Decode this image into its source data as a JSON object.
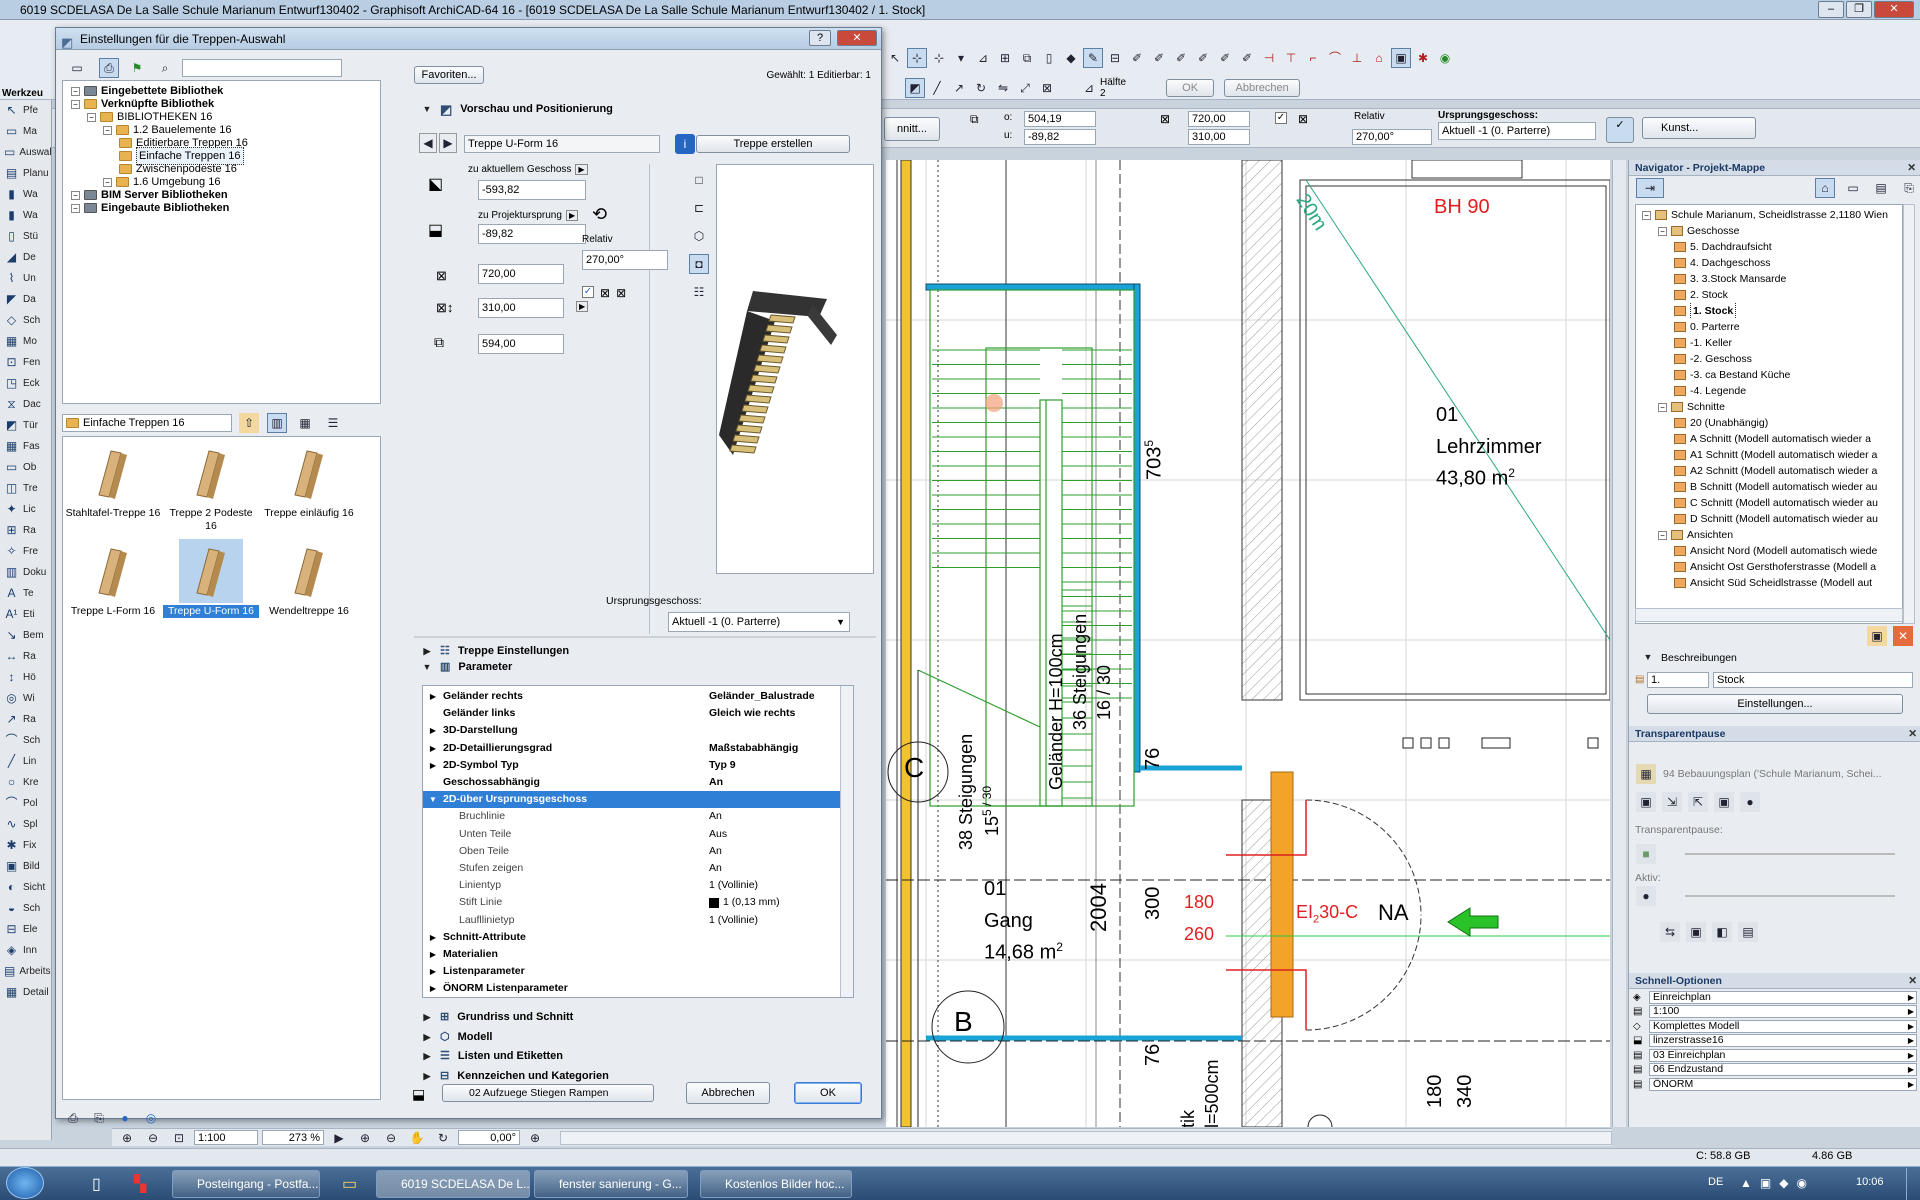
{
  "window": {
    "title": "6019 SCDELASA De La Salle Schule Marianum Entwurf130402 - Graphisoft ArchiCAD-64 16 - [6019 SCDELASA De La Salle Schule Marianum Entwurf130402 / 1. Stock]"
  },
  "toolbar": {
    "ok_label": "OK",
    "cancel_label": "Abbrechen",
    "half_label": "Hälfte",
    "half_value": "2"
  },
  "infobox": {
    "btn_partial": "nnitt...",
    "o_label": "o:",
    "o_value": "504,19",
    "u_label": "u:",
    "u_value": "-89,82",
    "w_value": "720,00",
    "h_value": "310,00",
    "relativ_label": "Relativ",
    "angle_value": "270,00°",
    "origin_label": "Ursprungsgeschoss:",
    "origin_value": "Aktuell -1 (0. Parterre)",
    "kunst_label": "Kunst..."
  },
  "leftpalette": {
    "header": "Werkzeu",
    "items": [
      "Pfe",
      "Ma",
      "Auswahl",
      "Planu",
      "Wa",
      "Wa",
      "Stü",
      "De",
      "Un",
      "Da",
      "Sch",
      "Mo",
      "Fen",
      "Eck",
      "Dac",
      "Tür",
      "Fas",
      "Ob",
      "Tre",
      "Lic",
      "Ra",
      "Fre",
      "Doku",
      "Te",
      "Eti",
      "Bem",
      "Ra",
      "Hö",
      "Wi",
      "Ra",
      "Sch",
      "Lin",
      "Kre",
      "Pol",
      "Spl",
      "Fix",
      "Bild",
      "Sicht",
      "Sch",
      "Ele",
      "Inn",
      "Arbeitsbl",
      "Detail"
    ]
  },
  "dialog": {
    "title": "Einstellungen für die Treppen-Auswahl",
    "favorites": "Favoriten...",
    "selected_info": "Gewählt: 1 Editierbar: 1",
    "library_tree": [
      {
        "label": "Eingebettete Bibliothek",
        "bold": true,
        "level": 0
      },
      {
        "label": "Verknüpfte Bibliothek",
        "bold": true,
        "level": 0
      },
      {
        "label": "BIBLIOTHEKEN 16",
        "bold": false,
        "level": 1
      },
      {
        "label": "1.2 Bauelemente 16",
        "bold": false,
        "level": 2
      },
      {
        "label": "Editierbare Treppen 16",
        "bold": false,
        "level": 3
      },
      {
        "label": "Einfache Treppen 16",
        "bold": false,
        "level": 3,
        "selected": true
      },
      {
        "label": "Zwischenpodeste 16",
        "bold": false,
        "level": 3
      },
      {
        "label": "1.6 Umgebung 16",
        "bold": false,
        "level": 2
      },
      {
        "label": "BIM Server Bibliotheken",
        "bold": true,
        "level": 0
      },
      {
        "label": "Eingebaute Bibliotheken",
        "bold": true,
        "level": 0
      }
    ],
    "folder_select": "Einfache Treppen 16",
    "objects": [
      {
        "label": "Stahltafel-Treppe 16"
      },
      {
        "label": "Treppe 2 Podeste 16"
      },
      {
        "label": "Treppe einläufig 16"
      },
      {
        "label": "Treppe L-Form 16"
      },
      {
        "label": "Treppe U-Form 16",
        "selected": true
      },
      {
        "label": "Wendeltreppe 16"
      }
    ],
    "preview_section": "Vorschau und Positionierung",
    "object_name": "Treppe U-Form 16",
    "create_btn": "Treppe erstellen",
    "to_current_story": "zu aktuellem Geschoss",
    "val_story": "-593,82",
    "to_project_origin": "zu Projektursprung",
    "val_origin": "-89,82",
    "val_width": "720,00",
    "val_depth": "310,00",
    "val_height": "594,00",
    "relativ": "Relativ",
    "angle": "270,00°",
    "origin_story_label": "Ursprungsgeschoss:",
    "origin_story_value": "Aktuell -1 (0. Parterre)",
    "section_stair": "Treppe Einstellungen",
    "section_params": "Parameter",
    "params": [
      {
        "name": "Geländer rechts",
        "value": "Geländer_Balustrade",
        "bold": true,
        "exp": "▶",
        "indent": 0
      },
      {
        "name": "Geländer links",
        "value": "Gleich wie rechts",
        "bold": true,
        "exp": "",
        "indent": 0
      },
      {
        "name": "3D-Darstellung",
        "value": "",
        "bold": true,
        "exp": "▶",
        "indent": 0
      },
      {
        "name": "2D-Detaillierungsgrad",
        "value": "Maßstababhängig",
        "bold": true,
        "exp": "▶",
        "indent": 0
      },
      {
        "name": "2D-Symbol Typ",
        "value": "Typ 9",
        "bold": true,
        "exp": "▶",
        "indent": 0
      },
      {
        "name": "Geschossabhängig",
        "value": "An",
        "bold": true,
        "exp": "",
        "indent": 0
      },
      {
        "name": "2D-über Ursprungsgeschoss",
        "value": "",
        "bold": true,
        "exp": "▼",
        "indent": 0,
        "selected": true
      },
      {
        "name": "Bruchlinie",
        "value": "An",
        "bold": false,
        "exp": "",
        "indent": 1
      },
      {
        "name": "Unten Teile",
        "value": "Aus",
        "bold": false,
        "exp": "",
        "indent": 1
      },
      {
        "name": "Oben Teile",
        "value": "An",
        "bold": false,
        "exp": "",
        "indent": 1
      },
      {
        "name": "Stufen zeigen",
        "value": "An",
        "bold": false,
        "exp": "",
        "indent": 1
      },
      {
        "name": "Linientyp",
        "value": "1 (Vollinie)",
        "bold": false,
        "exp": "",
        "indent": 1
      },
      {
        "name": "Stift Linie",
        "value": "1 (0,13 mm)",
        "bold": false,
        "exp": "",
        "indent": 1,
        "swatch": true
      },
      {
        "name": "Laufllinietyp",
        "value": "1 (Vollinie)",
        "bold": false,
        "exp": "",
        "indent": 1
      },
      {
        "name": "Schnitt-Attribute",
        "value": "",
        "bold": true,
        "exp": "▶",
        "indent": 0
      },
      {
        "name": "Materialien",
        "value": "",
        "bold": true,
        "exp": "▶",
        "indent": 0
      },
      {
        "name": "Listenparameter",
        "value": "",
        "bold": true,
        "exp": "▶",
        "indent": 0
      },
      {
        "name": "ÖNORM Listenparameter",
        "value": "",
        "bold": true,
        "exp": "▶",
        "indent": 0
      }
    ],
    "sections_bottom": [
      "Grundriss und Schnitt",
      "Modell",
      "Listen und Etiketten",
      "Kennzeichen und Kategorien"
    ],
    "layer": "02 Aufzuege Stiegen Rampen",
    "cancel": "Abbrechen",
    "ok": "OK"
  },
  "plan": {
    "bh": "BH 90",
    "dim20": "20m",
    "room1_num": "01",
    "room1_name": "Lehrzimmer",
    "room1_area": "43,80 m",
    "sq": "2",
    "room2_num": "01",
    "room2_name": "Gang",
    "room2_area": "14,68 m",
    "steps38": "38 Steigungen",
    "steps38b": "15",
    "steps38c": "5 / 30",
    "steps36": "36 Steigungen",
    "steps36b": "16 / 30",
    "rail": "Geländer H=100cm",
    "d703": "703",
    "d703s": "5",
    "d76a": "76",
    "d2004": "2004",
    "d300": "300",
    "d76b": "76",
    "c": "C",
    "b": "B",
    "r180": "180",
    "r260": "260",
    "ei": "EI",
    "ei2": "2",
    "ei3": "30-C",
    "na": "NA",
    "b180": "180",
    "b340": "340",
    "btm1": "tik",
    "btm2": "l=500cm"
  },
  "navigator": {
    "title": "Navigator - Projekt-Mappe",
    "items": [
      {
        "label": "Schule Marianum, Scheidlstrasse 2,1180 Wien",
        "level": 0
      },
      {
        "label": "Geschosse",
        "level": 1
      },
      {
        "label": "5. Dachdraufsicht",
        "level": 2
      },
      {
        "label": "4. Dachgeschoss",
        "level": 2
      },
      {
        "label": "3. 3.Stock Mansarde",
        "level": 2
      },
      {
        "label": "2. Stock",
        "level": 2
      },
      {
        "label": "1. Stock",
        "level": 2,
        "selected": true
      },
      {
        "label": "0. Parterre",
        "level": 2
      },
      {
        "label": "-1. Keller",
        "level": 2
      },
      {
        "label": "-2. Geschoss",
        "level": 2
      },
      {
        "label": "-3. ca Bestand Küche",
        "level": 2
      },
      {
        "label": "-4. Legende",
        "level": 2
      },
      {
        "label": "Schnitte",
        "level": 1
      },
      {
        "label": "20 (Unabhängig)",
        "level": 2
      },
      {
        "label": "A Schnitt (Modell automatisch wieder a",
        "level": 2
      },
      {
        "label": "A1 Schnitt (Modell automatisch wieder a",
        "level": 2
      },
      {
        "label": "A2 Schnitt (Modell automatisch wieder a",
        "level": 2
      },
      {
        "label": "B Schnitt (Modell automatisch wieder au",
        "level": 2
      },
      {
        "label": "C Schnitt (Modell automatisch wieder au",
        "level": 2
      },
      {
        "label": "D Schnitt (Modell automatisch wieder au",
        "level": 2
      },
      {
        "label": "Ansichten",
        "level": 1
      },
      {
        "label": "Ansicht Nord (Modell automatisch wiede",
        "level": 2
      },
      {
        "label": "Ansicht Ost Gersthoferstrasse (Modell a",
        "level": 2
      },
      {
        "label": "Ansicht Süd Scheidlstrasse (Modell aut",
        "level": 2
      }
    ],
    "desc_head": "Beschreibungen",
    "desc_num": "1.",
    "desc_name": "Stock",
    "settings_btn": "Einstellungen..."
  },
  "transparent": {
    "title": "Transparentpause",
    "ref": "94 Bebauungsplan ('Schule Marianum, Schei...",
    "pause": "Transparentpause:",
    "active": "Aktiv:"
  },
  "quick": {
    "title": "Schnell-Optionen",
    "items": [
      "Einreichplan",
      "1:100",
      "Komplettes Modell",
      "linzerstrasse16",
      "03 Einreichplan",
      "06 Endzustand",
      "ÖNORM"
    ]
  },
  "status": {
    "scale": "1:100",
    "zoom": "273 %",
    "angle": "0,00°",
    "disk": "C: 58.8 GB",
    "mem": "4.86 GB"
  },
  "taskbar": {
    "items": [
      "Posteingang - Postfa...",
      "6019 SCDELASA De L...",
      "fenster sanierung - G...",
      "Kostenlos Bilder hoc..."
    ],
    "lang": "DE",
    "time": "10:06"
  }
}
